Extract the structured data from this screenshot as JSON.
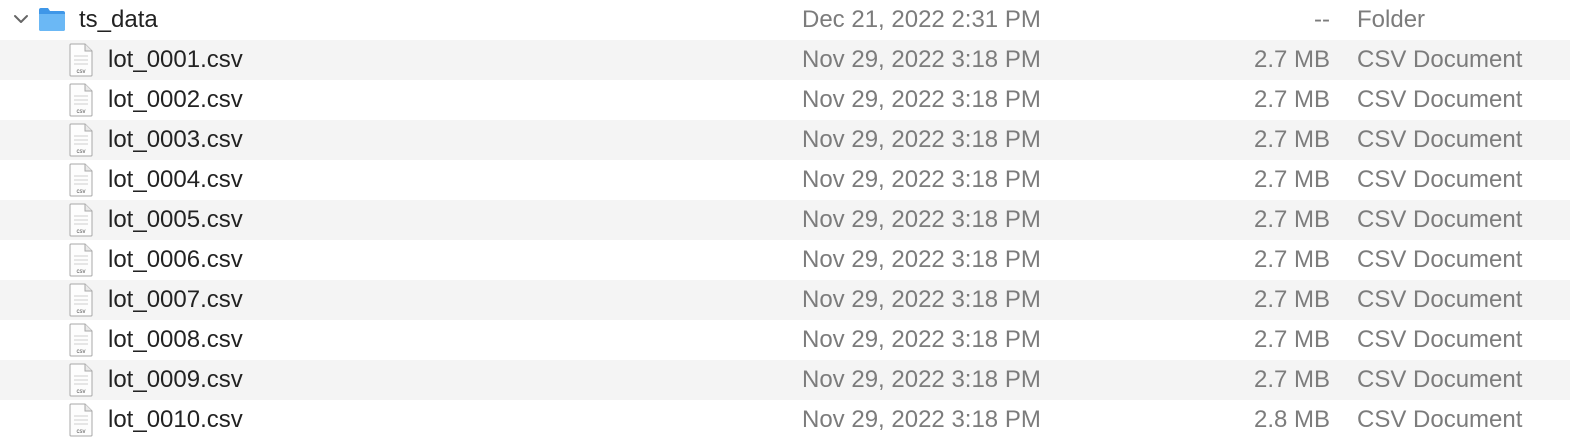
{
  "folder": {
    "name": "ts_data",
    "date_modified": "Dec 21, 2022 2:31 PM",
    "size": "--",
    "kind": "Folder",
    "expanded": true,
    "icon": "folder-icon",
    "color": "#5aaef2"
  },
  "files": [
    {
      "name": "lot_0001.csv",
      "date_modified": "Nov 29, 2022 3:18 PM",
      "size": "2.7 MB",
      "kind": "CSV Document"
    },
    {
      "name": "lot_0002.csv",
      "date_modified": "Nov 29, 2022 3:18 PM",
      "size": "2.7 MB",
      "kind": "CSV Document"
    },
    {
      "name": "lot_0003.csv",
      "date_modified": "Nov 29, 2022 3:18 PM",
      "size": "2.7 MB",
      "kind": "CSV Document"
    },
    {
      "name": "lot_0004.csv",
      "date_modified": "Nov 29, 2022 3:18 PM",
      "size": "2.7 MB",
      "kind": "CSV Document"
    },
    {
      "name": "lot_0005.csv",
      "date_modified": "Nov 29, 2022 3:18 PM",
      "size": "2.7 MB",
      "kind": "CSV Document"
    },
    {
      "name": "lot_0006.csv",
      "date_modified": "Nov 29, 2022 3:18 PM",
      "size": "2.7 MB",
      "kind": "CSV Document"
    },
    {
      "name": "lot_0007.csv",
      "date_modified": "Nov 29, 2022 3:18 PM",
      "size": "2.7 MB",
      "kind": "CSV Document"
    },
    {
      "name": "lot_0008.csv",
      "date_modified": "Nov 29, 2022 3:18 PM",
      "size": "2.7 MB",
      "kind": "CSV Document"
    },
    {
      "name": "lot_0009.csv",
      "date_modified": "Nov 29, 2022 3:18 PM",
      "size": "2.7 MB",
      "kind": "CSV Document"
    },
    {
      "name": "lot_0010.csv",
      "date_modified": "Nov 29, 2022 3:18 PM",
      "size": "2.8 MB",
      "kind": "CSV Document"
    }
  ],
  "file_icon": {
    "name": "csv-file-icon",
    "badge": "csv"
  }
}
